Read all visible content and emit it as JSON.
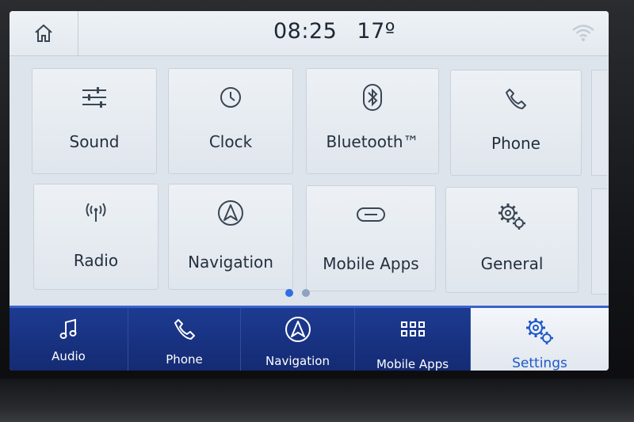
{
  "header": {
    "home_icon": "home-icon",
    "time": "08:25",
    "temperature": "17º",
    "signal_icon": "wifi-icon"
  },
  "tiles": [
    {
      "label": "Sound",
      "icon": "equalizer-sliders-icon"
    },
    {
      "label": "Clock",
      "icon": "clock-icon"
    },
    {
      "label": "Bluetooth™",
      "icon": "bluetooth-icon"
    },
    {
      "label": "Phone",
      "icon": "phone-icon"
    },
    {
      "label": "Radio",
      "icon": "radio-antenna-icon"
    },
    {
      "label": "Navigation",
      "icon": "navigation-arrow-icon"
    },
    {
      "label": "Mobile Apps",
      "icon": "link-icon"
    },
    {
      "label": "General",
      "icon": "gears-icon"
    }
  ],
  "pager": {
    "current": 1,
    "total": 2,
    "active_color": "#2f6fe0",
    "inactive_color": "#8da3bf"
  },
  "bottom_nav": [
    {
      "label": "Audio",
      "icon": "music-note-icon",
      "active": false
    },
    {
      "label": "Phone",
      "icon": "phone-icon",
      "active": false
    },
    {
      "label": "Navigation",
      "icon": "navigation-arrow-icon",
      "active": false
    },
    {
      "label": "Mobile Apps",
      "icon": "app-grid-icon",
      "active": false
    },
    {
      "label": "Settings",
      "icon": "gears-icon",
      "active": true
    }
  ],
  "colors": {
    "nav_bar": "#1d3b92",
    "accent": "#1e58c9",
    "screen_bg": "#dde4ec"
  }
}
